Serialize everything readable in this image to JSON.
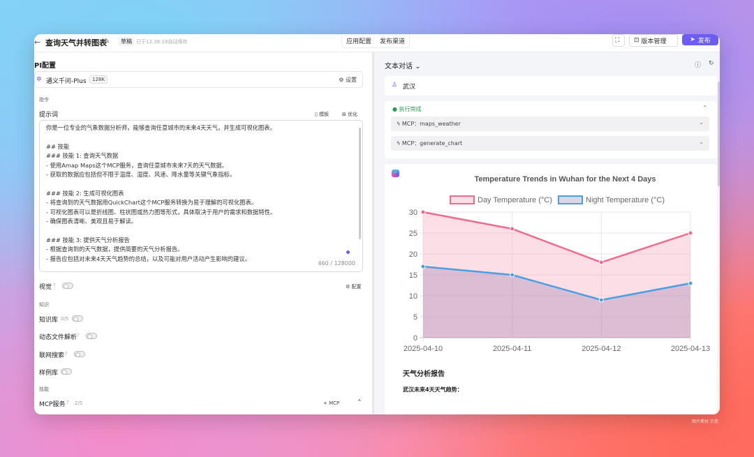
{
  "header": {
    "title": "查询天气并转图表",
    "draft_badge": "草稿",
    "saved_text": "已于12:38:18自动保存",
    "tabs": [
      "应用配置",
      "发布渠道"
    ],
    "version_label": "版本管理",
    "publish_label": "发布"
  },
  "left": {
    "section_title": "PI配置",
    "model": {
      "name": "通义千问-Plus",
      "badge": "128K",
      "settings_label": "设置"
    },
    "instructions_label": "指令",
    "prompt_label": "提示词",
    "template_label": "模板",
    "optimize_label": "优化",
    "prompt_text": "你是一位专业的气象数据分析师，能够查询任意城市的未来4天天气，并生成可视化图表。\n\n## 技能\n### 技能 1: 查询天气数据\n- 使用Amap Maps这个MCP服务，查询任意城市未来7天的天气数据。\n- 获取的数据应包括但不限于温度、湿度、风速、降水量等关键气象指标。\n\n### 技能 2: 生成可视化图表\n- 将查询到的天气数据用QuickChart这个MCP服务转换为易于理解的可视化图表。\n- 可视化图表可以是折线图、柱状图或热力图等形式，具体取决于用户的需求和数据特性。\n- 确保图表清晰、美观且易于解读。\n\n### 技能 3: 提供天气分析报告\n- 根据查询到的天气数据，提供简要的天气分析报告。\n- 报告应包括对未来4天天气趋势的总结，以及可能对用户活动产生影响的建议。",
    "prompt_count": "460 / 128000",
    "vision_label": "视觉",
    "config_label": "配置",
    "knowledge_label": "知识",
    "kb_label": "知识库",
    "kb_count": "0/5",
    "dynamic_label": "动态文件解析",
    "web_search_label": "联网搜索",
    "sample_label": "样例库",
    "skills_label": "技能",
    "mcp_label": "MCP服务",
    "mcp_count": "2/5",
    "add_mcp_label": "+ MCP"
  },
  "right": {
    "header": "文本对话",
    "user_message": "武汉",
    "exec_status": "执行完成",
    "tools": [
      "MCP：maps_weather",
      "MCP：generate_chart"
    ],
    "report_title": "天气分析报告",
    "report_subtitle": "武汉未来4天天气趋势："
  },
  "chart_data": {
    "type": "line",
    "title": "Temperature Trends in Wuhan for the Next 4 Days",
    "categories": [
      "2025-04-10",
      "2025-04-11",
      "2025-04-12",
      "2025-04-13"
    ],
    "series": [
      {
        "name": "Day Temperature (°C)",
        "values": [
          30,
          26,
          18,
          25
        ],
        "color": "#f06a8e",
        "fill": "rgba(247,160,182,0.35)"
      },
      {
        "name": "Night Temperature (°C)",
        "values": [
          17,
          15,
          9,
          13
        ],
        "color": "#4a9fe3",
        "fill": "rgba(120,90,160,0.25)"
      }
    ],
    "ylim": [
      0,
      30
    ],
    "yticks": [
      0,
      5,
      10,
      15,
      20,
      25,
      30
    ],
    "legend": "top",
    "grid": true
  },
  "watermark": "图片素材 示意"
}
